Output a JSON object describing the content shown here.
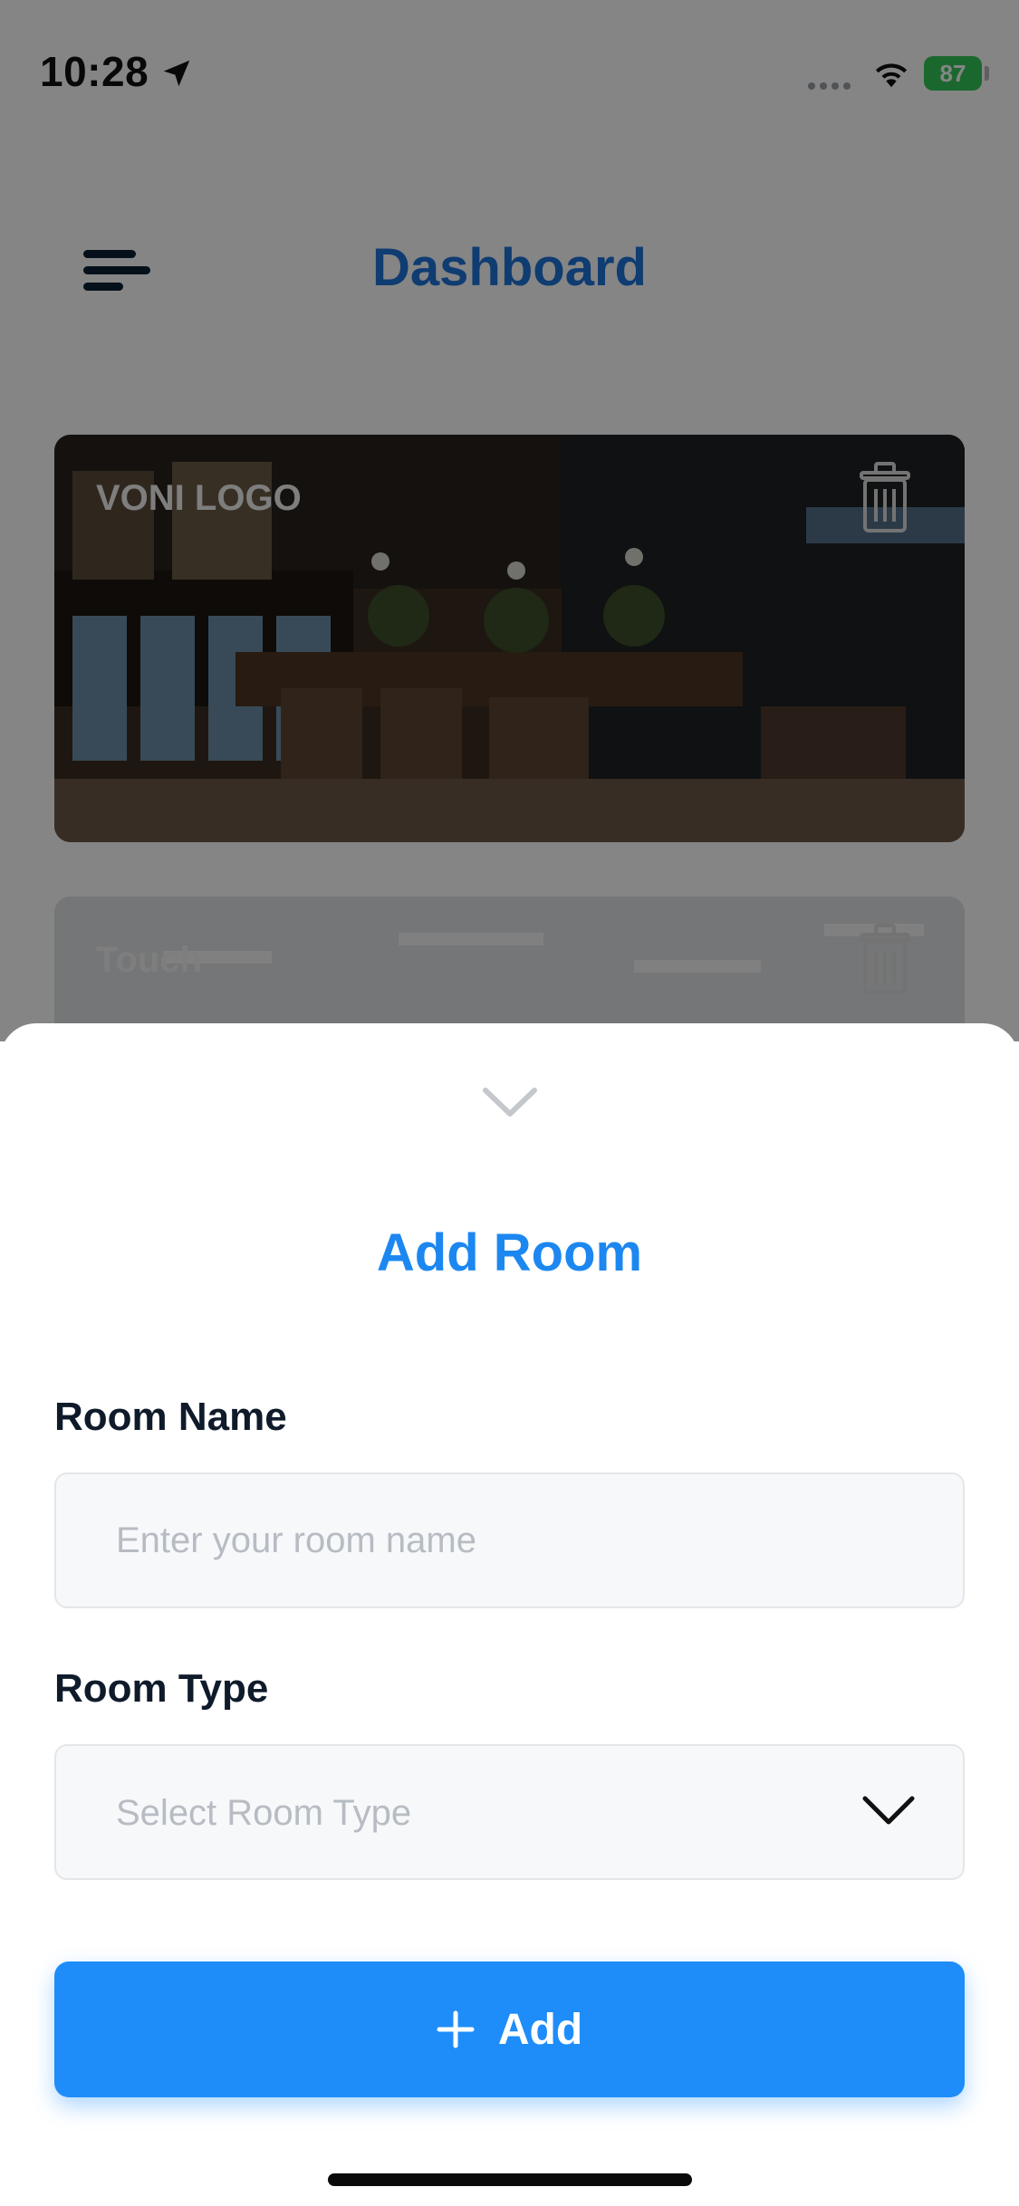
{
  "status_bar": {
    "time": "10:28",
    "battery": "87",
    "battery_color": "#34c759"
  },
  "header": {
    "title": "Dashboard",
    "menu_icon": "menu-icon"
  },
  "rooms": [
    {
      "label": "VONI LOGO",
      "icon": "trash-icon"
    },
    {
      "label": "Touch",
      "icon": "trash-icon"
    }
  ],
  "sheet": {
    "title": "Add Room",
    "room_name": {
      "label": "Room Name",
      "placeholder": "Enter your room name",
      "value": ""
    },
    "room_type": {
      "label": "Room Type",
      "placeholder": "Select Room Type",
      "icon": "chevron-down-icon"
    },
    "add_button": {
      "label": "Add",
      "icon": "plus-icon",
      "color": "#1e8df9"
    }
  },
  "colors": {
    "title_blue": "#1e73d8",
    "accent_blue": "#1c87f0"
  }
}
